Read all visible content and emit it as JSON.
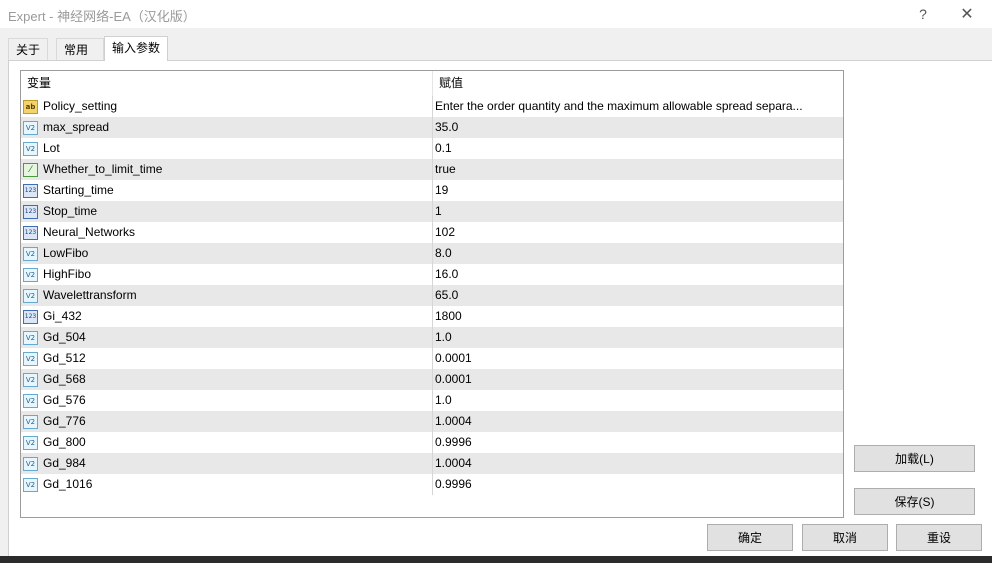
{
  "window": {
    "title": "Expert - 神经网络-EA（汉化版）",
    "help_glyph": "?",
    "close_glyph": "✕"
  },
  "tabs": [
    {
      "label": "关于",
      "active": false
    },
    {
      "label": "常用",
      "active": false
    },
    {
      "label": "输入参数",
      "active": true
    }
  ],
  "table": {
    "headers": {
      "variable": "变量",
      "value": "赋值"
    },
    "rows": [
      {
        "icon": "string-type-icon",
        "icon_text": "ab",
        "name": "Policy_setting",
        "value": "Enter the order quantity and the maximum allowable spread separa..."
      },
      {
        "icon": "double-type-icon",
        "icon_text": "V2",
        "name": "max_spread",
        "value": "35.0"
      },
      {
        "icon": "double-type-icon",
        "icon_text": "V2",
        "name": "Lot",
        "value": "0.1"
      },
      {
        "icon": "bool-type-icon",
        "icon_text": "⁄",
        "name": "Whether_to_limit_time",
        "value": "true"
      },
      {
        "icon": "integer-type-icon",
        "icon_text": "123",
        "name": "Starting_time",
        "value": "19"
      },
      {
        "icon": "integer-type-icon",
        "icon_text": "123",
        "name": "Stop_time",
        "value": "1"
      },
      {
        "icon": "integer-type-icon",
        "icon_text": "123",
        "name": "Neural_Networks",
        "value": "102"
      },
      {
        "icon": "double-type-icon",
        "icon_text": "V2",
        "name": "LowFibo",
        "value": "8.0"
      },
      {
        "icon": "double-type-icon",
        "icon_text": "V2",
        "name": "HighFibo",
        "value": "16.0"
      },
      {
        "icon": "double-type-icon",
        "icon_text": "V2",
        "name": "Wavelettransform",
        "value": "65.0"
      },
      {
        "icon": "integer-type-icon",
        "icon_text": "123",
        "name": "Gi_432",
        "value": "1800"
      },
      {
        "icon": "double-type-icon",
        "icon_text": "V2",
        "name": "Gd_504",
        "value": "1.0"
      },
      {
        "icon": "double-type-icon",
        "icon_text": "V2",
        "name": "Gd_512",
        "value": "0.0001"
      },
      {
        "icon": "double-type-icon",
        "icon_text": "V2",
        "name": "Gd_568",
        "value": "0.0001"
      },
      {
        "icon": "double-type-icon",
        "icon_text": "V2",
        "name": "Gd_576",
        "value": "1.0"
      },
      {
        "icon": "double-type-icon",
        "icon_text": "V2",
        "name": "Gd_776",
        "value": "1.0004"
      },
      {
        "icon": "double-type-icon",
        "icon_text": "V2",
        "name": "Gd_800",
        "value": "0.9996"
      },
      {
        "icon": "double-type-icon",
        "icon_text": "V2",
        "name": "Gd_984",
        "value": "1.0004"
      },
      {
        "icon": "double-type-icon",
        "icon_text": "V2",
        "name": "Gd_1016",
        "value": "0.9996"
      }
    ]
  },
  "side_buttons": {
    "load": "加载(L)",
    "save": "保存(S)"
  },
  "footer_buttons": {
    "ok": "确定",
    "cancel": "取消",
    "reset": "重设"
  }
}
